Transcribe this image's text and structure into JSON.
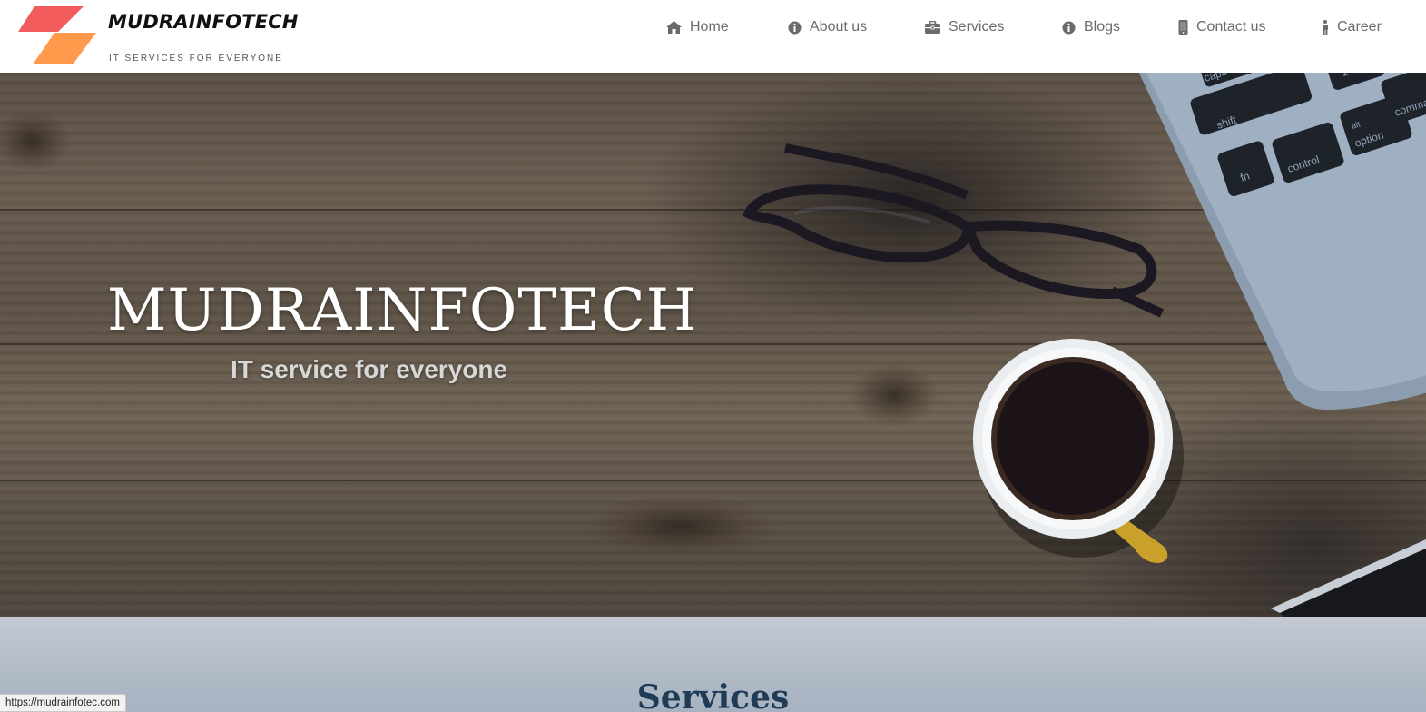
{
  "brand": {
    "name": "MUDRAINFOTECH",
    "tagline": "IT  SERVICES FOR EVERYONE",
    "colors": {
      "primary": "#f25c5c",
      "secondary": "#ff9a4d"
    }
  },
  "nav": {
    "items": [
      {
        "label": "Home",
        "icon": "home-icon"
      },
      {
        "label": "About us",
        "icon": "info-circle-icon"
      },
      {
        "label": "Services",
        "icon": "briefcase-icon"
      },
      {
        "label": "Blogs",
        "icon": "info-circle-icon"
      },
      {
        "label": "Contact us",
        "icon": "mobile-phone-icon"
      },
      {
        "label": "Career",
        "icon": "person-icon"
      }
    ]
  },
  "hero": {
    "title": "MUDRAINFOTECH",
    "subtitle": "IT service for everyone",
    "laptop_keys": [
      "caps",
      "shift",
      "fn",
      "control",
      "alt",
      "option",
      "command",
      "z"
    ]
  },
  "services": {
    "title": "Services"
  },
  "status_bar": {
    "url": "https://mudrainfotec.com"
  }
}
